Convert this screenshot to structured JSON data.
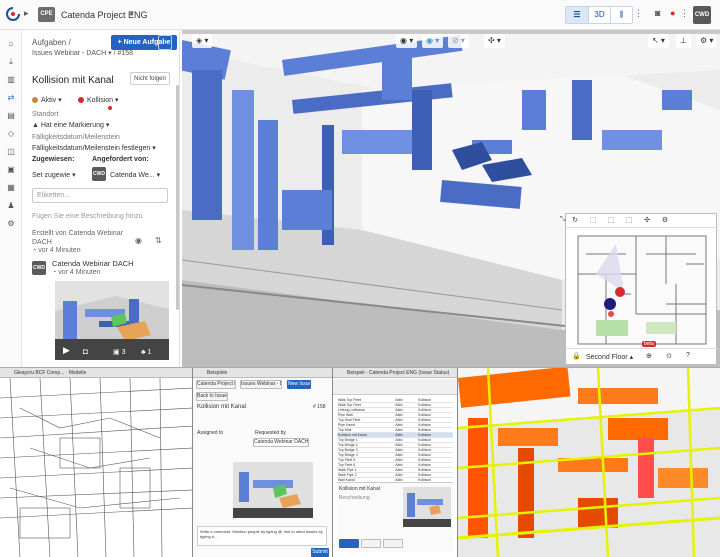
{
  "topbar": {
    "project_initials": "CPE",
    "project_name": "Catenda Project ENG",
    "view_3d": "3D",
    "user_initials": "CWD"
  },
  "issue_panel": {
    "breadcrumb_1": "Aufgaben /",
    "breadcrumb_2": "Issues Webinar - DACH ▾ / #158",
    "new_issue_button": "+ Neue Aufgabe",
    "title": "Kollision mit Kanal",
    "unfollow_button": "Nicht folgen",
    "status": "Aktiv",
    "type": "Kollision",
    "location_label": "Standort",
    "location_value": "Hat eine Markierung",
    "due_label": "Fälligkeitsdatum/Meilenstein",
    "due_value": "Fälligkeitsdatum/Meilenstein festlegen",
    "assigned_label": "Zugewiesen:",
    "assigned_value": "Set zugewie",
    "requested_label": "Angefordert von:",
    "requested_value": "Catenda We...",
    "requester_initials": "CWD",
    "labels_placeholder": "Etiketten...",
    "description_placeholder": "Fügen Sie eine Beschreibung hinzu",
    "created_text": "Erstellt von Catenda Webinar DACH",
    "created_time": "vor 4 Minuten",
    "comment_author": "Catenda Webinar DACH",
    "comment_time": "vor 4 Minuten",
    "comment_initials": "CWD",
    "thumb_count_1": "3",
    "thumb_count_2": "1"
  },
  "viewer": {
    "floor_label": "Second Floor",
    "badge": "beta",
    "status_color": "#d62b2b",
    "duct_color": "#5b7fd6",
    "bottom_right_hint_color": "#ff7a1a"
  },
  "bottom_windows": {
    "left_title": "Gleaycru BCF Comp... · Modelle",
    "mid_title": "Beispiele",
    "mid_tab_1": "Catenda Project ENG",
    "mid_tab_2": "Issues Webinar - DAC",
    "mid_new_button": "New Issue",
    "mid_back": "Back to Issues",
    "mid_issue_title": "Kollision mit Kanal",
    "mid_issue_id": "# 158",
    "mid_assigned": "Assigned to",
    "mid_requested": "Requested by",
    "mid_requester": "Catenda Webinar DACH",
    "mid_comment_hint": "Write a comment. Mention people by typing @, link to other issues by typing #...",
    "mid_submit": "Submit",
    "grid_title": "Beispiel - Catenda Project ENG (Issue Status)",
    "grid_rows": [
      [
        "Walk Top Fleet",
        "Aktiv",
        "Kollision"
      ],
      [
        "Walk Top Fleet",
        "Aktiv",
        "Kollision"
      ],
      [
        "Leitung Luftkanal",
        "Aktiv",
        "Kollision"
      ],
      [
        "Pipe Wall",
        "Aktiv",
        "Kollision"
      ],
      [
        "Top Seal Fleet",
        "Aktiv",
        "Kollision"
      ],
      [
        "Pipe Kanal",
        "Aktiv",
        "Kollision"
      ],
      [
        "Top Wall",
        "Aktiv",
        "Kollision"
      ],
      [
        "Kollision mit Kanal",
        "Aktiv",
        "Kollision"
      ],
      [
        "Top Bridge 1",
        "Aktiv",
        "Kollision"
      ],
      [
        "Top Bridge 2",
        "Aktiv",
        "Kollision"
      ],
      [
        "Top Bridge 3",
        "Aktiv",
        "Kollision"
      ],
      [
        "Top Bridge 4",
        "Aktiv",
        "Kollision"
      ],
      [
        "Top Fleet 5",
        "Aktiv",
        "Kollision"
      ],
      [
        "Top Fleet 6",
        "Aktiv",
        "Kollision"
      ],
      [
        "Walk Pipe 1",
        "Aktiv",
        "Kollision"
      ],
      [
        "Walk Pipe 2",
        "Aktiv",
        "Kollision"
      ],
      [
        "Wall Kanal",
        "Aktiv",
        "Kollision"
      ]
    ],
    "grid_bottom_title": "Kollision mit Kanal",
    "grid_bottom_sub": "Beschreibung"
  }
}
